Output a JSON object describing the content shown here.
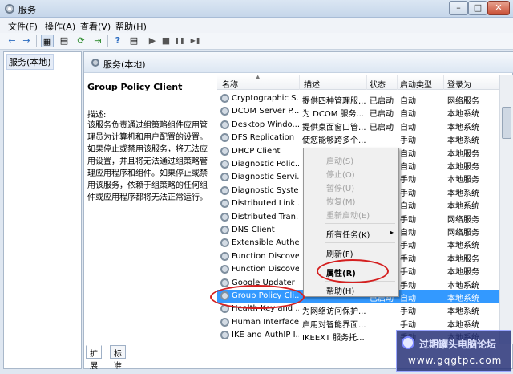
{
  "window": {
    "title": "服务",
    "min_glyph": "–",
    "max_glyph": "□",
    "close_glyph": "✕"
  },
  "menubar": {
    "items": [
      "文件(F)",
      "操作(A)",
      "查看(V)",
      "帮助(H)"
    ]
  },
  "toolbar": {
    "glyphs": {
      "back": "←",
      "forward": "→",
      "view": "▦",
      "list": "▤",
      "refresh": "⟳",
      "export": "⇥",
      "help": "?",
      "props": "▤",
      "play": "▶",
      "stop": "■",
      "pause": "❚❚",
      "restart": "▶❚"
    }
  },
  "tree": {
    "item": "服务(本地)"
  },
  "content": {
    "header": "服务(本地)"
  },
  "desc_pane": {
    "service_name": "Group Policy Client",
    "label": "描述:",
    "text": "该服务负责通过组策略组件应用管理员为计算机和用户配置的设置。如果停止或禁用该服务，将无法应用设置，并且将无法通过组策略管理应用程序和组件。如果停止或禁用该服务，依赖于组策略的任何组件或应用程序都将无法正常运行。"
  },
  "list": {
    "columns": [
      "名称",
      "描述",
      "状态",
      "启动类型",
      "登录为"
    ],
    "rows": [
      {
        "name": "Cryptographic S...",
        "desc": "提供四种管理服...",
        "status": "已启动",
        "type": "自动",
        "logon": "网络服务"
      },
      {
        "name": "DCOM Server P...",
        "desc": "为 DCOM 服务...",
        "status": "已启动",
        "type": "自动",
        "logon": "本地系统"
      },
      {
        "name": "Desktop Windo...",
        "desc": "提供桌面窗口管...",
        "status": "已启动",
        "type": "自动",
        "logon": "本地系统"
      },
      {
        "name": "DFS Replication",
        "desc": "使您能够跨多个...",
        "status": "",
        "type": "手动",
        "logon": "本地系统"
      },
      {
        "name": "DHCP Client",
        "desc": "",
        "status": "",
        "type": "自动",
        "logon": "本地服务"
      },
      {
        "name": "Diagnostic Polic...",
        "desc": "",
        "status": "",
        "type": "自动",
        "logon": "本地服务"
      },
      {
        "name": "Diagnostic Servi...",
        "desc": "",
        "status": "",
        "type": "手动",
        "logon": "本地服务"
      },
      {
        "name": "Diagnostic Syste...",
        "desc": "",
        "status": "",
        "type": "手动",
        "logon": "本地系统"
      },
      {
        "name": "Distributed Link ...",
        "desc": "",
        "status": "",
        "type": "自动",
        "logon": "本地系统"
      },
      {
        "name": "Distributed Tran...",
        "desc": "",
        "status": "",
        "type": "手动",
        "logon": "网络服务"
      },
      {
        "name": "DNS Client",
        "desc": "",
        "status": "",
        "type": "自动",
        "logon": "网络服务"
      },
      {
        "name": "Extensible Authe...",
        "desc": "",
        "status": "",
        "type": "手动",
        "logon": "本地系统"
      },
      {
        "name": "Function Discove...",
        "desc": "",
        "status": "",
        "type": "手动",
        "logon": "本地服务"
      },
      {
        "name": "Function Discove...",
        "desc": "",
        "status": "",
        "type": "手动",
        "logon": "本地服务"
      },
      {
        "name": "Google Updater",
        "desc": "",
        "status": "",
        "type": "手动",
        "logon": "本地系统"
      },
      {
        "name": "Group Policy Cli...",
        "desc": "",
        "status": "已启动",
        "type": "自动",
        "logon": "本地系统"
      },
      {
        "name": "Health Key and ...",
        "desc": "为网络访问保护...",
        "status": "",
        "type": "手动",
        "logon": "本地系统"
      },
      {
        "name": "Human Interface...",
        "desc": "启用对智能界面...",
        "status": "",
        "type": "手动",
        "logon": "本地系统"
      },
      {
        "name": "IKE and AuthIP I...",
        "desc": "IKEEXT 服务托...",
        "status": "",
        "type": "手动",
        "logon": "本地系统"
      }
    ]
  },
  "context_menu": {
    "items": [
      "启动(S)",
      "停止(O)",
      "暂停(U)",
      "恢复(M)",
      "重新启动(E)",
      "所有任务(K)",
      "刷新(F)",
      "属性(R)",
      "帮助(H)"
    ],
    "submenu_arrow": "▸"
  },
  "bottom_tabs": [
    "扩展",
    "标准"
  ],
  "watermark": {
    "title": "过期罐头电脑论坛",
    "url": "www.gqgtpc.com"
  },
  "colors": {
    "selection": "#3399ff",
    "annotation": "#d41f1f"
  }
}
